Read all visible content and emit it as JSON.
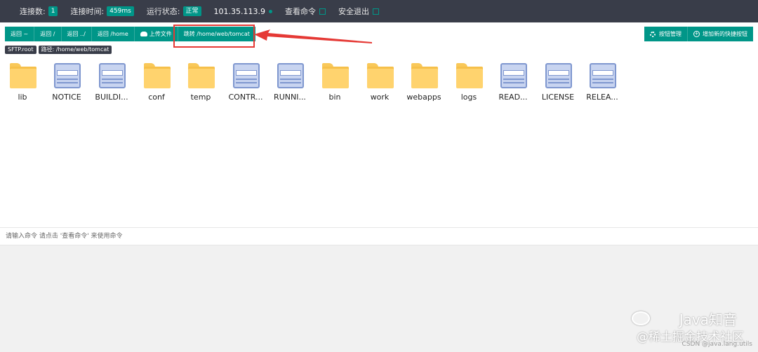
{
  "topbar": {
    "connections_label": "连接数:",
    "connections_value": "1",
    "conn_time_label": "连接时间:",
    "conn_time_value": "459ms",
    "status_label": "运行状态:",
    "status_value": "正常",
    "ip": "101.35.113.9",
    "view_commands": "查看命令",
    "logout": "安全退出"
  },
  "toolbar": {
    "buttons": [
      "返回 ~",
      "返回 /",
      "返回 ../",
      "返回 /home",
      "上传文件",
      "跳转 /home/web/tomcat"
    ],
    "right_buttons": [
      "按钮管理",
      "增加新的快捷按钮"
    ]
  },
  "tags": {
    "sftp": "SFTP.root",
    "path": "路径: /home/web/tomcat"
  },
  "files": [
    {
      "name": "lib",
      "type": "folder"
    },
    {
      "name": "NOTICE",
      "type": "doc"
    },
    {
      "name": "BUILDI...",
      "type": "doc"
    },
    {
      "name": "conf",
      "type": "folder"
    },
    {
      "name": "temp",
      "type": "folder"
    },
    {
      "name": "CONTR...",
      "type": "doc"
    },
    {
      "name": "RUNNI...",
      "type": "doc"
    },
    {
      "name": "bin",
      "type": "folder"
    },
    {
      "name": "work",
      "type": "folder"
    },
    {
      "name": "webapps",
      "type": "folder"
    },
    {
      "name": "logs",
      "type": "folder"
    },
    {
      "name": "READ...",
      "type": "doc"
    },
    {
      "name": "LICENSE",
      "type": "doc"
    },
    {
      "name": "RELEA...",
      "type": "doc"
    }
  ],
  "command_hint": "请输入命令 请点击 '查看命令' 来使用命令",
  "watermark": {
    "line1": "Java知音",
    "line2": "@稀土掘金技术社区",
    "csdn": "CSDN @java.lang.utils"
  },
  "colors": {
    "primary": "#009688",
    "topbar": "#393d49",
    "highlight": "#e53935"
  }
}
